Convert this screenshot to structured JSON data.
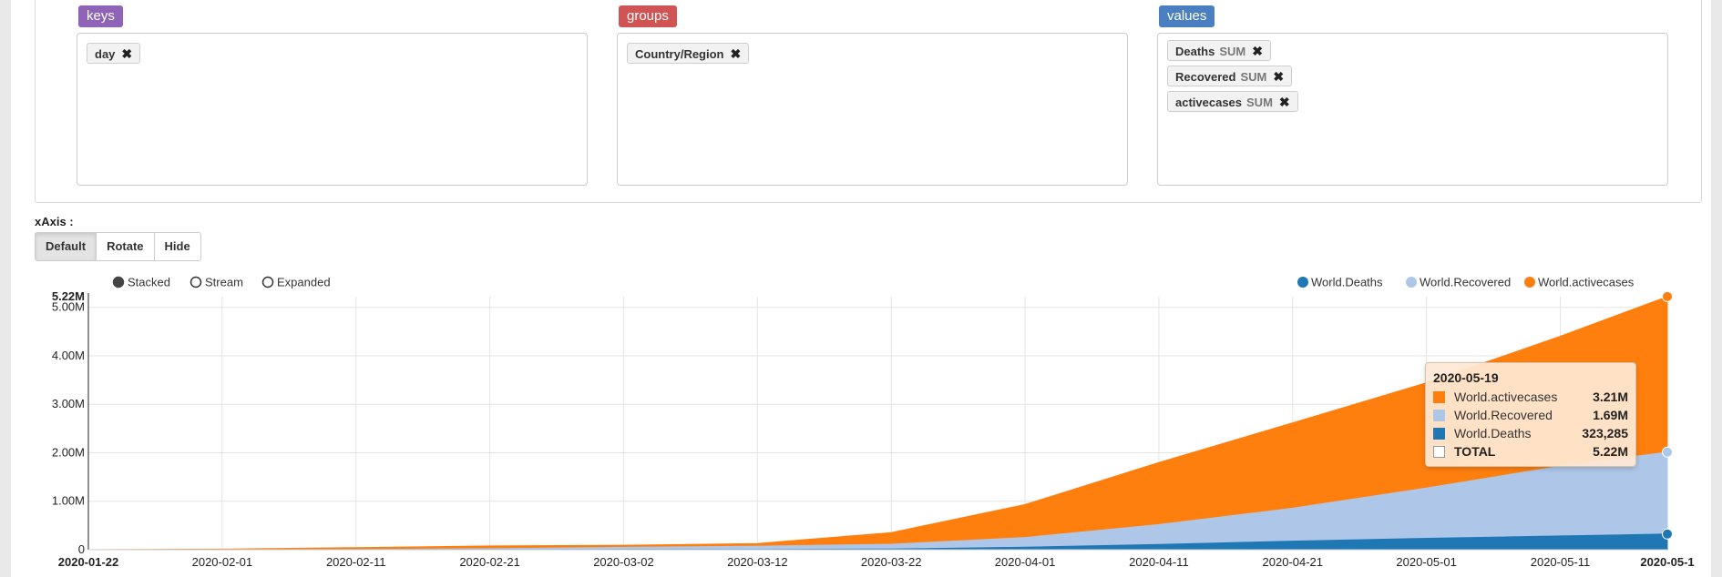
{
  "pivot": {
    "keys": {
      "title": "keys",
      "color": "#8e63b8",
      "items": [
        {
          "label": "day",
          "remove": "✖"
        }
      ]
    },
    "groups": {
      "title": "groups",
      "color": "#d05454",
      "items": [
        {
          "label": "Country/Region",
          "remove": "✖"
        }
      ]
    },
    "values": {
      "title": "values",
      "color": "#4a7fc1",
      "items": [
        {
          "label": "Deaths",
          "agg": "SUM",
          "remove": "✖"
        },
        {
          "label": "Recovered",
          "agg": "SUM",
          "remove": "✖"
        },
        {
          "label": "activecases",
          "agg": "SUM",
          "remove": "✖"
        }
      ]
    }
  },
  "xaxis": {
    "label": "xAxis :",
    "buttons": [
      "Default",
      "Rotate",
      "Hide"
    ],
    "active": "Default"
  },
  "modes": {
    "options": [
      "Stacked",
      "Stream",
      "Expanded"
    ],
    "selected": "Stacked"
  },
  "chart_data": {
    "type": "area",
    "stacked": true,
    "x_ticks": [
      "2020-01-22",
      "2020-02-01",
      "2020-02-11",
      "2020-02-21",
      "2020-03-02",
      "2020-03-12",
      "2020-03-22",
      "2020-04-01",
      "2020-04-11",
      "2020-04-21",
      "2020-05-01",
      "2020-05-11",
      "2020-05-1"
    ],
    "y_ticks": [
      "0",
      "1.00M",
      "2.00M",
      "3.00M",
      "4.00M",
      "5.00M"
    ],
    "y_max_label": "5.22M",
    "ylim": [
      0,
      5220000
    ],
    "grid": true,
    "legend_position": "top-right",
    "x": [
      "2020-01-22",
      "2020-02-01",
      "2020-02-11",
      "2020-02-21",
      "2020-03-02",
      "2020-03-12",
      "2020-03-22",
      "2020-04-01",
      "2020-04-11",
      "2020-04-21",
      "2020-05-01",
      "2020-05-11",
      "2020-05-19"
    ],
    "series": [
      {
        "name": "World.Deaths",
        "color": "#1f77b4",
        "values": [
          17,
          259,
          1018,
          2247,
          3117,
          4720,
          14700,
          51500,
          108000,
          177000,
          234000,
          284000,
          323285
        ]
      },
      {
        "name": "World.Recovered",
        "color": "#aec7e8",
        "values": [
          30,
          300,
          5000,
          18000,
          46000,
          68000,
          98000,
          200000,
          410000,
          680000,
          1040000,
          1440000,
          1690000
        ]
      },
      {
        "name": "World.activecases",
        "color": "#ff7f0e",
        "values": [
          510,
          11400,
          37000,
          56000,
          42000,
          55000,
          240000,
          680000,
          1280000,
          1760000,
          2170000,
          2680000,
          3210000
        ]
      }
    ]
  },
  "tooltip": {
    "date": "2020-05-19",
    "rows": [
      {
        "name": "World.activecases",
        "value": "3.21M",
        "color": "#ff7f0e"
      },
      {
        "name": "World.Recovered",
        "value": "1.69M",
        "color": "#aec7e8"
      },
      {
        "name": "World.Deaths",
        "value": "323,285",
        "color": "#1f77b4"
      },
      {
        "name": "TOTAL",
        "value": "5.22M",
        "color": "#ffffff"
      }
    ]
  }
}
